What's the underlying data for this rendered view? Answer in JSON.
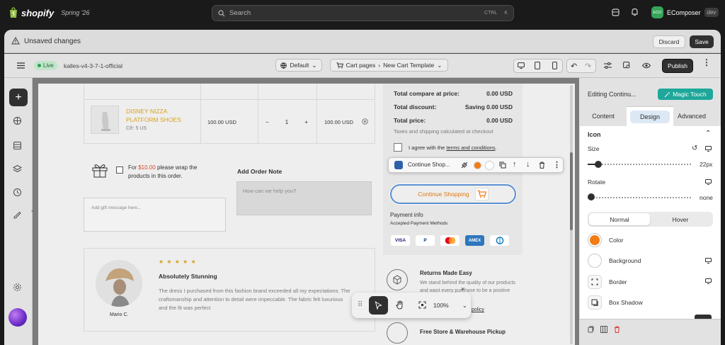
{
  "topbar": {
    "brand": "shopify",
    "edition": "Spring '26",
    "search_placeholder": "Search",
    "shortcut_ctrl": "CTRL",
    "shortcut_k": "K",
    "account_initials": "ECO",
    "account_name": "EComposer",
    "account_badge": "dev"
  },
  "unsaved": {
    "label": "Unsaved changes",
    "discard": "Discard",
    "save": "Save"
  },
  "toolbar": {
    "live": "Live",
    "theme_name": "kalles-v4-3-7-1-official",
    "language": "Default",
    "page_type": "Cart pages",
    "template": "New Cart Template",
    "publish": "Publish"
  },
  "cart_item": {
    "name_line1": "DISNEY NIZZA",
    "name_line2": "PLATFORM SHOES",
    "variant": "Cỡ: 5 US",
    "price": "100.00 USD",
    "qty": "1",
    "total": "100.00 USD",
    "minus": "−",
    "plus": "+"
  },
  "gift": {
    "text_pre": "For",
    "amount": "$10.00",
    "text_post": "please wrap the",
    "text_line2": "products in this order.",
    "message_placeholder": "Add gift message here..."
  },
  "order_note": {
    "title": "Add Order Note",
    "placeholder": "How can we help you?"
  },
  "summary": {
    "compare_label": "Total compare at price:",
    "compare_value": "0.00 USD",
    "discount_label": "Total discount:",
    "discount_value": "Saving 0.00 USD",
    "total_label": "Total price:",
    "total_value": "0.00 USD",
    "taxes_note": "Taxes and shipping calculated at checkout",
    "agree_pre": "I agree with the",
    "agree_link": "terms and conditions",
    "continue_label": "Continue Shopping",
    "ctx_label": "Continue Shop...",
    "payment_title": "Payment info",
    "payment_sub": "Accepted Payment Methods",
    "payment_methods": [
      "VISA",
      "P",
      "MC",
      "AMEX",
      "DC"
    ]
  },
  "review": {
    "stars": "★ ★ ★ ★ ★",
    "title": "Absolutely Stunning",
    "body_line1": "The dress I purchased from this fashion brand exceeded all my expectations. The",
    "body_line2": "craftsmanship and attention to detail were impeccable. The fabric felt luxurious",
    "body_line3": "and the fit was perfect",
    "author": "Mario C."
  },
  "features": {
    "returns_title": "Returns Made Easy",
    "returns_line1": "We stand behind the quality of our products",
    "returns_line2": "and want every purchase to be a positive",
    "returns_link": "policy",
    "shipping_title": "Free Store & Warehouse Pickup"
  },
  "floatbar": {
    "zoom": "100%"
  },
  "panel": {
    "title": "Editing Continu...",
    "magic": "Magic Touch",
    "tab_content": "Content",
    "tab_design": "Design",
    "tab_advanced": "Advanced",
    "section_icon": "Icon",
    "size_label": "Size",
    "size_value": "22px",
    "size_fraction": 0.1,
    "rotate_label": "Rotate",
    "rotate_value": "none",
    "state_normal": "Normal",
    "state_hover": "Hover",
    "color_label": "Color",
    "color_value": "#f37b12",
    "background_label": "Background",
    "border_label": "Border",
    "shadow_label": "Box Shadow"
  }
}
